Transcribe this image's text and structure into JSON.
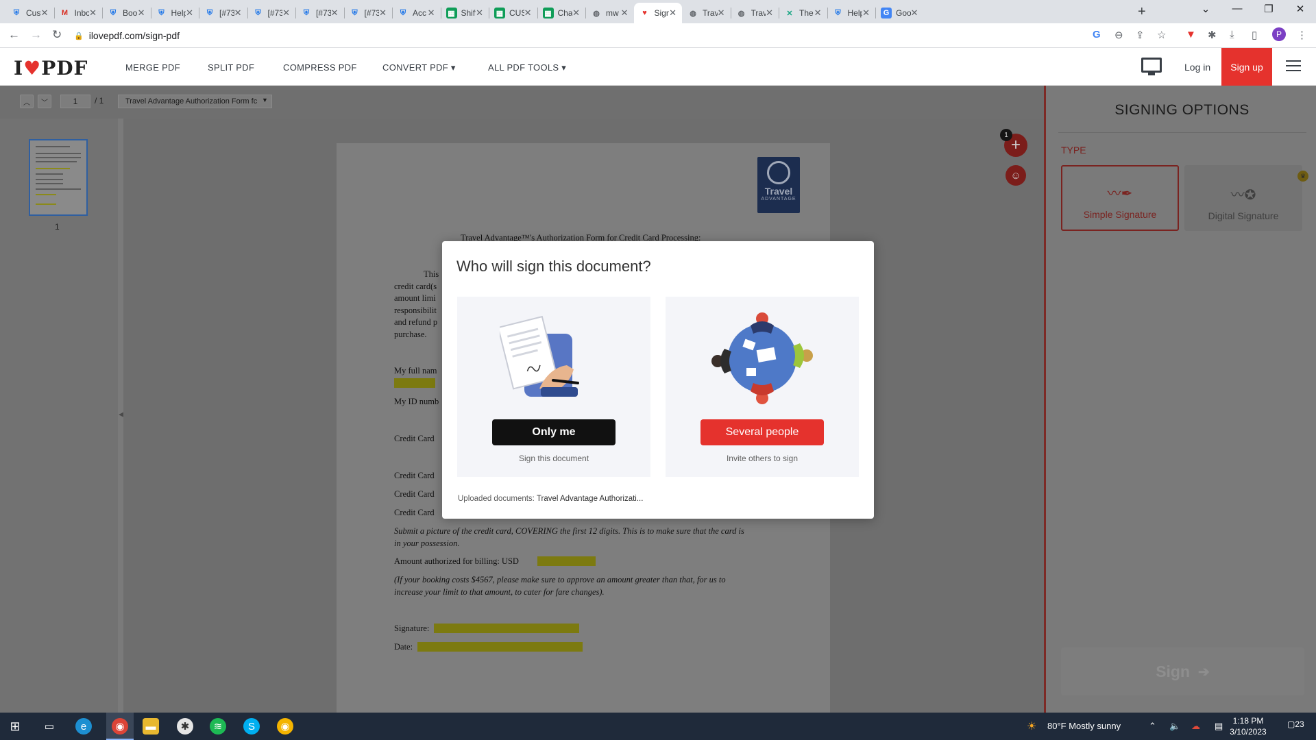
{
  "browser": {
    "tabs": [
      {
        "icon": "shield-icon",
        "label": "Cust"
      },
      {
        "icon": "gmail-icon",
        "label": "Inbc"
      },
      {
        "icon": "shield-icon",
        "label": "Boo"
      },
      {
        "icon": "shield-icon",
        "label": "Help"
      },
      {
        "icon": "shield-icon",
        "label": "[#73"
      },
      {
        "icon": "shield-icon",
        "label": "[#73"
      },
      {
        "icon": "shield-icon",
        "label": "[#73"
      },
      {
        "icon": "shield-icon",
        "label": "[#73"
      },
      {
        "icon": "shield-icon",
        "label": "Acc"
      },
      {
        "icon": "sheets-icon",
        "label": "Shift"
      },
      {
        "icon": "sheets-icon",
        "label": "CUS"
      },
      {
        "icon": "sheets-icon",
        "label": "Cha"
      },
      {
        "icon": "globe-icon",
        "label": "mw"
      },
      {
        "icon": "ilovepdf-icon",
        "label": "Sign"
      },
      {
        "icon": "globe-icon",
        "label": "Trav"
      },
      {
        "icon": "globe-icon",
        "label": "Trav"
      },
      {
        "icon": "x-icon",
        "label": "The"
      },
      {
        "icon": "shield-icon",
        "label": "Help"
      },
      {
        "icon": "translate-icon",
        "label": "Goo"
      }
    ],
    "active_tab_index": 13,
    "url": "ilovepdf.com/sign-pdf",
    "profile_initial": "P"
  },
  "site": {
    "logo_left": "I",
    "logo_right": "PDF",
    "nav": [
      "MERGE PDF",
      "SPLIT PDF",
      "COMPRESS PDF",
      "CONVERT PDF ▾",
      "ALL PDF TOOLS ▾"
    ],
    "login": "Log in",
    "signup": "Sign up",
    "brand_color": "#e5322d"
  },
  "viewer": {
    "page_current": "1",
    "page_total": "/ 1",
    "file_selector": "Travel Advantage Authorization Form fc",
    "thumb_label": "1",
    "badge_count": "1"
  },
  "document": {
    "logo_text": "Travel",
    "logo_sub": "ADVANTAGE",
    "title": "Travel Advantage™'s Authorization Form for Credit Card Processing:",
    "lines": [
      "This",
      "credit card(s",
      "amount limi",
      "responsibilit",
      "and refund p",
      "purchase.",
      "My full nam",
      "My ID numb",
      "Credit Card",
      "Credit Card",
      "Credit Card",
      "Credit Card"
    ],
    "submit_note_1": "Submit a picture of the credit card, COVERING the first 12 digits. This is to make sure that the card is",
    "submit_note_2": "in your possession.",
    "amount_label": "Amount authorized for billing: USD",
    "booking_note_1": "(If your booking costs $4567, please make sure to approve an amount greater than that, for us to",
    "booking_note_2": "increase your limit to that amount, to cater for fare changes).",
    "signature_label": "Signature:",
    "date_label": "Date:"
  },
  "panel": {
    "title": "SIGNING OPTIONS",
    "type_label": "TYPE",
    "simple": "Simple Signature",
    "digital": "Digital Signature",
    "sign_button": "Sign"
  },
  "modal": {
    "title": "Who will sign this document?",
    "only_me": "Only me",
    "only_me_sub": "Sign this document",
    "several": "Several people",
    "several_sub": "Invite others to sign",
    "uploaded_label": "Uploaded documents:",
    "uploaded_file": "Travel Advantage Authorizati..."
  },
  "taskbar": {
    "weather": "80°F  Mostly sunny",
    "time": "1:18 PM",
    "date": "3/10/2023",
    "notifications": "23"
  }
}
